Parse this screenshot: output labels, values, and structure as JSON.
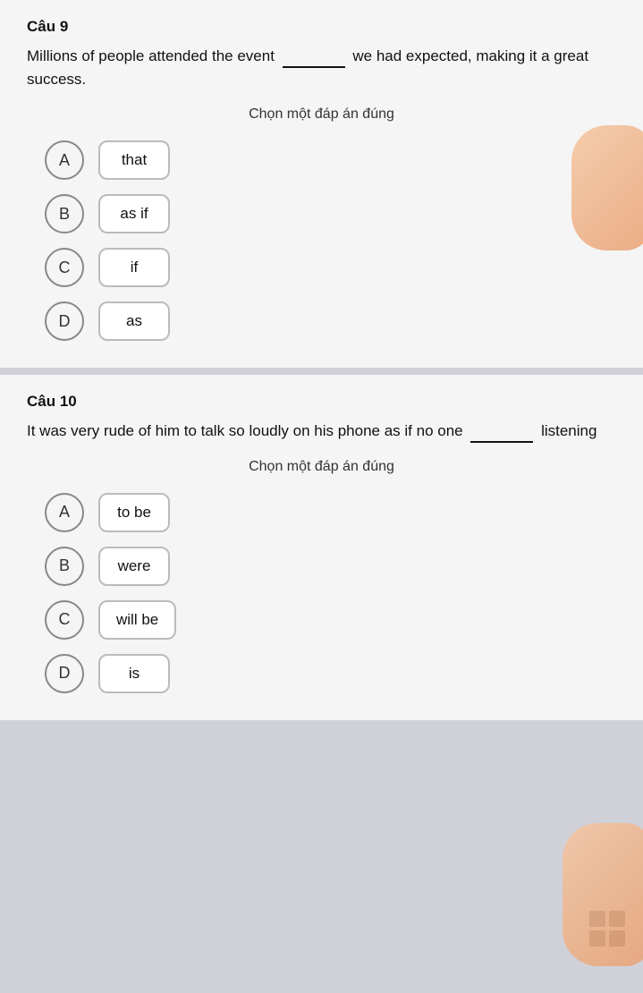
{
  "questions": [
    {
      "id": "cau9",
      "number": "Câu 9",
      "text_before_blank": "Millions of people attended the event",
      "text_after_blank": "we had expected, making it a great success.",
      "instruction": "Chọn một đáp án đúng",
      "options": [
        {
          "id": "A",
          "label": "that"
        },
        {
          "id": "B",
          "label": "as if"
        },
        {
          "id": "C",
          "label": "if"
        },
        {
          "id": "D",
          "label": "as"
        }
      ]
    },
    {
      "id": "cau10",
      "number": "Câu 10",
      "text_before_blank": "It was very rude of him to talk so loudly on his phone as if no one",
      "text_after_blank": "listening",
      "instruction": "Chọn một đáp án đúng",
      "options": [
        {
          "id": "A",
          "label": "to be"
        },
        {
          "id": "B",
          "label": "were"
        },
        {
          "id": "C",
          "label": "will be"
        },
        {
          "id": "D",
          "label": "is"
        }
      ]
    }
  ]
}
